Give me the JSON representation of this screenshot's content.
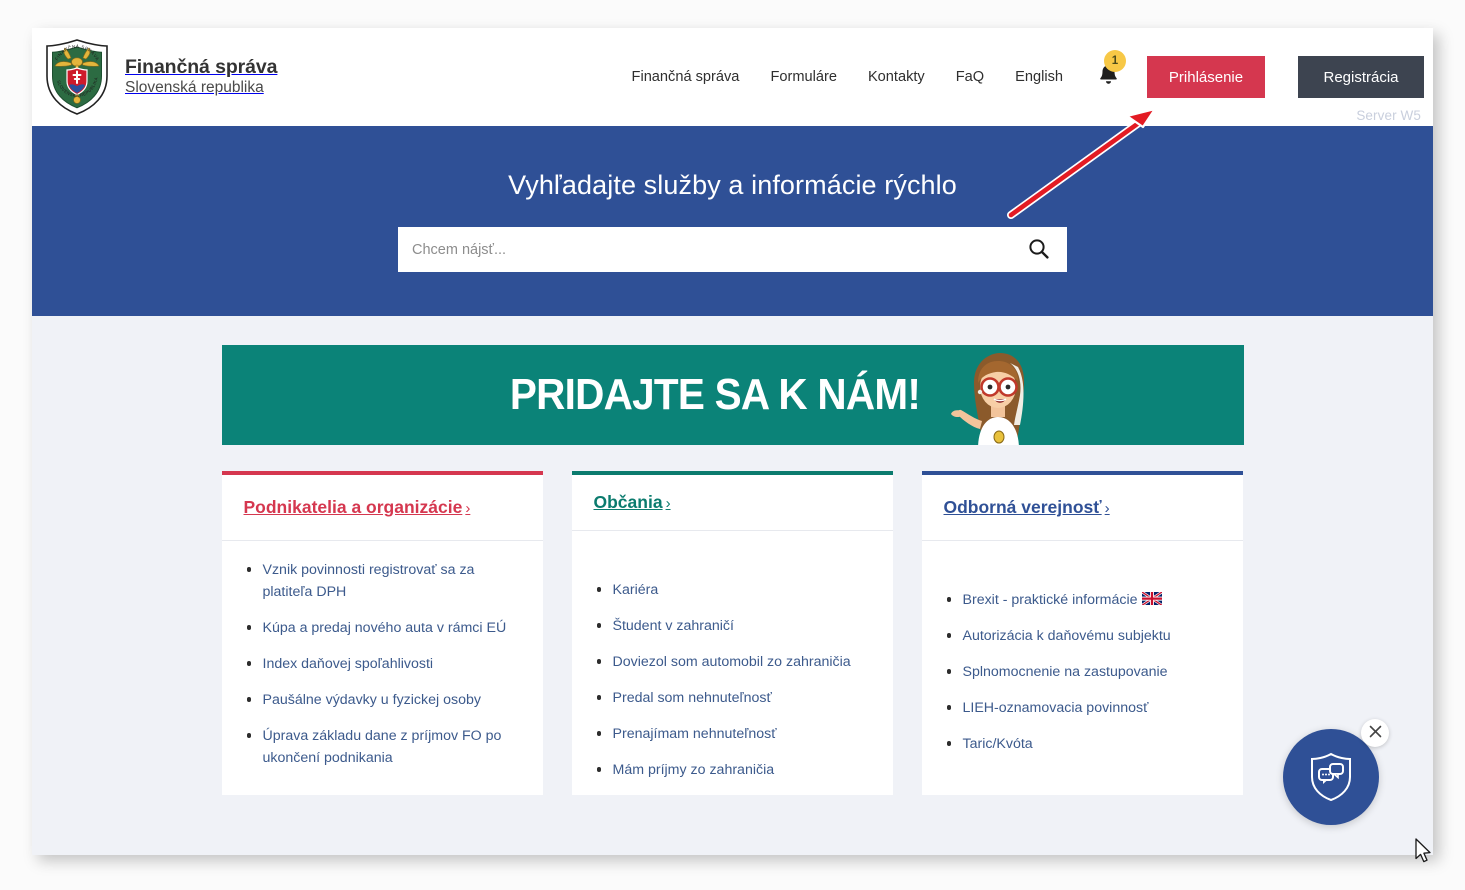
{
  "header": {
    "brand": {
      "line1": "Finančná správa",
      "line2": "Slovenská republika",
      "logo_icon": "financna-sprava-shield-emblem"
    },
    "nav": [
      {
        "label": "Finančná správa"
      },
      {
        "label": "Formuláre"
      },
      {
        "label": "Kontakty"
      },
      {
        "label": "FaQ"
      },
      {
        "label": "English"
      }
    ],
    "notifications": {
      "icon": "bell-icon",
      "count": "1",
      "badge_color": "#F7C846"
    },
    "login_button": {
      "label": "Prihlásenie",
      "color": "#D5374F"
    },
    "register_button": {
      "label": "Registrácia",
      "color": "#3D4450"
    },
    "server_tag": "Server W5"
  },
  "hero": {
    "title": "Vyhľadajte služby a informácie rýchlo",
    "background_color": "#2F5096",
    "search": {
      "placeholder": "Chcem nájsť...",
      "value": "",
      "icon": "search-icon"
    }
  },
  "promo": {
    "text": "PRIDAJTE SA K NÁM!",
    "background_color": "#0B8378",
    "figure_icon": "cartoon-woman-with-glasses"
  },
  "cards": [
    {
      "title": "Podnikatelia a organizácie",
      "chevron": "›",
      "accent_color": "#D5374F",
      "items": [
        {
          "label": "Vznik povinnosti registrovať sa za platiteľa DPH"
        },
        {
          "label": "Kúpa a predaj nového auta v rámci EÚ"
        },
        {
          "label": "Index daňovej spoľahlivosti"
        },
        {
          "label": "Paušálne výdavky u fyzickej osoby"
        },
        {
          "label": "Úprava základu dane z príjmov FO po ukončení podnikania"
        }
      ]
    },
    {
      "title": "Občania",
      "chevron": "›",
      "accent_color": "#0B7B6E",
      "items": [
        {
          "label": "Kariéra"
        },
        {
          "label": "Študent v zahraničí"
        },
        {
          "label": "Doviezol som automobil zo zahraničia"
        },
        {
          "label": "Predal som nehnuteľnosť"
        },
        {
          "label": "Prenajímam nehnuteľnosť"
        },
        {
          "label": "Mám príjmy zo zahraničia"
        }
      ]
    },
    {
      "title": "Odborná verejnosť",
      "chevron": "›",
      "accent_color": "#2F5096",
      "items": [
        {
          "label": "Brexit - praktické informácie",
          "flag": "uk-flag-icon"
        },
        {
          "label": "Autorizácia k daňovému subjektu"
        },
        {
          "label": "Splnomocnenie na zastupovanie"
        },
        {
          "label": "LIEH-oznamovacia povinnosť"
        },
        {
          "label": "Taric/Kvóta"
        }
      ]
    }
  ],
  "chat_widget": {
    "icon": "shield-chat-icon",
    "close_icon": "close-icon",
    "background_color": "#2F5096"
  },
  "annotation": {
    "arrow_icon": "red-arrow-icon",
    "arrow_color": "#E31B23",
    "points_to": "Prihlásenie"
  },
  "cursor": {
    "icon": "mouse-pointer-icon"
  }
}
